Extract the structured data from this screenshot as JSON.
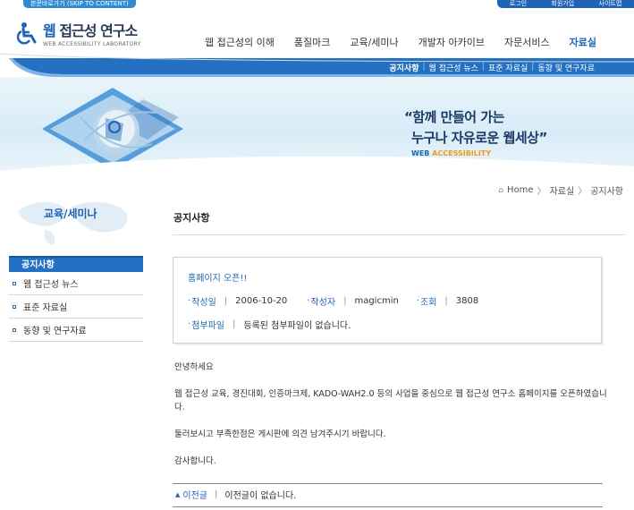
{
  "top": {
    "skip_link": "본문바로가기 (SKIP TO CONTENT)",
    "util_links": [
      "로그인",
      "회원가입",
      "사이트맵"
    ]
  },
  "logo": {
    "title_prefix": "웹",
    "title_rest": " 접근성 연구소",
    "subtitle": "WEB ACCESSIBILITY LABORATORY"
  },
  "gnb": {
    "items": [
      "웹 접근성의 이해",
      "품질마크",
      "교육/세미나",
      "개발자 아카이브",
      "자문서비스",
      "자료실"
    ],
    "active_index": 5
  },
  "subnav": {
    "items": [
      "공지사항",
      "웹 접근성 뉴스",
      "표준 자료실",
      "동향 및 연구자료"
    ],
    "active_index": 0
  },
  "hero": {
    "line1": "“함께 만들어 가는",
    "line2": "누구나 자유로운 웹세상”",
    "tag_web": "WEB ",
    "tag_acc": "ACCESSIBILITY"
  },
  "breadcrumb": [
    "Home",
    "자료실",
    "공지사항"
  ],
  "sidebar": {
    "title": "교육/세미나",
    "head": "공지사항",
    "items": [
      "웹 접근성 뉴스",
      "표준 자료실",
      "동향 및 연구자료"
    ]
  },
  "content": {
    "page_title": "공지사항",
    "post": {
      "title": "홈페이지 오픈!!",
      "date_label": "작성일",
      "date": "2006-10-20",
      "author_label": "작성자",
      "author": "magicmin",
      "views_label": "조회",
      "views": "3808",
      "attach_label": "첨부파일",
      "attach_value": "등록된 첨부파일이 없습니다."
    },
    "body": [
      "안녕하세요",
      "웹 접근성 교육, 경진대회, 인증마크제, KADO-WAH2.0 등의 사업을 중심으로 웹 접근성 연구소 홈페이지를 오픈하였습니다.",
      "둘러보시고 부족한점은 게시판에 의견 남겨주시기 바랍니다.",
      "감사합니다."
    ],
    "prev_label": "이전글",
    "prev_value": "이전글이 없습니다."
  },
  "colors": {
    "primary": "#1f63b5",
    "accent": "#f39a1e",
    "header_bar": "#2470c2"
  }
}
